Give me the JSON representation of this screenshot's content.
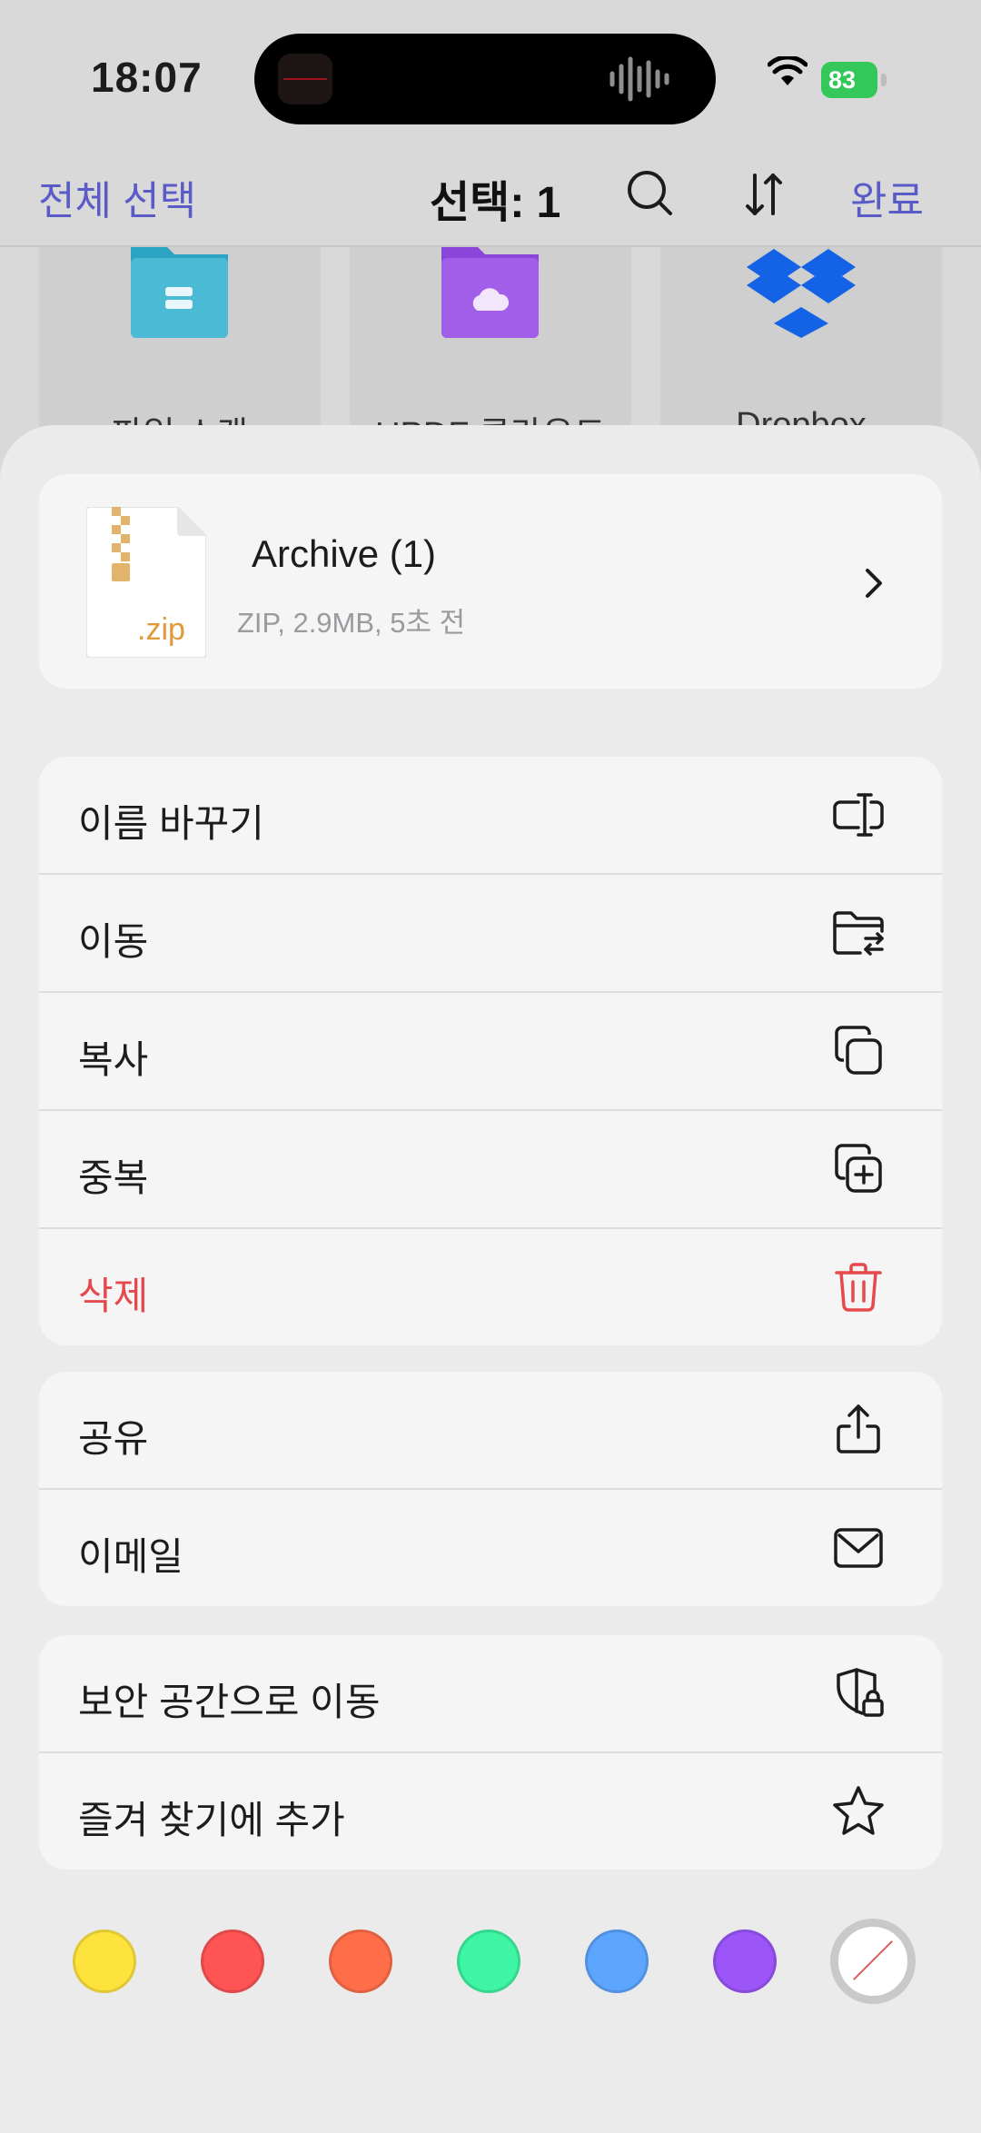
{
  "status_bar": {
    "time": "18:07",
    "battery": "83"
  },
  "nav": {
    "select_all": "전체 선택",
    "selected_count": "선택: 1",
    "done": "완료"
  },
  "background_tiles": [
    "파일 스캔",
    "UPDF 클라우드",
    "Dropbox"
  ],
  "file": {
    "name": "Archive (1)",
    "meta": "ZIP, 2.9MB, 5초 전",
    "ext": ".zip"
  },
  "menu_group_1": [
    {
      "label": "이름 바꾸기",
      "icon": "rename-icon"
    },
    {
      "label": "이동",
      "icon": "folder-move-icon"
    },
    {
      "label": "복사",
      "icon": "copy-icon"
    },
    {
      "label": "중복",
      "icon": "duplicate-icon"
    },
    {
      "label": "삭제",
      "icon": "trash-icon"
    }
  ],
  "menu_group_2": [
    {
      "label": "공유",
      "icon": "share-icon"
    },
    {
      "label": "이메일",
      "icon": "mail-icon"
    }
  ],
  "menu_group_3": [
    {
      "label": "보안 공간으로 이동",
      "icon": "secure-space-icon"
    },
    {
      "label": "즐겨 찾기에 추가",
      "icon": "star-icon"
    }
  ],
  "tag_colors": [
    "#ffe33d",
    "#ff5454",
    "#ff6e48",
    "#3df5a2",
    "#5da6ff",
    "#9b55f9"
  ],
  "accent_color": "#5a5bc7",
  "danger_color": "#e5484d"
}
